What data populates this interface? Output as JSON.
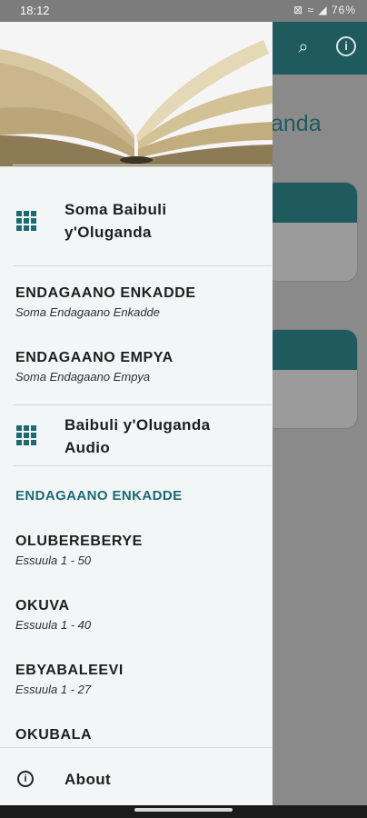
{
  "status_bar": {
    "time": "18:12",
    "indicators": "⊠ ≈ ◢ 76%"
  },
  "background": {
    "title_fragment": "anda",
    "search_icon": "search-icon",
    "info_icon": "info-icon"
  },
  "drawer": {
    "header_image": "open-book",
    "item_read": {
      "label_line1": "Soma Baibuli",
      "label_line2": "y'Oluganda",
      "icon": "grid-icon"
    },
    "old_testament": {
      "title": "ENDAGAANO ENKADDE",
      "subtitle": "Soma Endagaano Enkadde"
    },
    "new_testament": {
      "title": "ENDAGAANO EMPYA",
      "subtitle": "Soma Endagaano Empya"
    },
    "item_audio": {
      "label_line1": "Baibuli y'Oluganda",
      "label_line2": "Audio",
      "icon": "grid-icon"
    },
    "section_heading": "ENDAGAANO ENKADDE",
    "books": [
      {
        "title": "OLUBEREBERYE",
        "subtitle": "Essuula 1 - 50"
      },
      {
        "title": "OKUVA",
        "subtitle": "Essuula 1 - 40"
      },
      {
        "title": "EBYABALEEVI",
        "subtitle": "Essuula 1 - 27"
      },
      {
        "title": "OKUBALA",
        "subtitle": ""
      }
    ],
    "about": {
      "label": "About",
      "icon": "info-icon"
    }
  },
  "colors": {
    "accent": "#1c6a74",
    "appbar": "#1f5a5e",
    "drawer_bg": "#f3f6f6"
  }
}
